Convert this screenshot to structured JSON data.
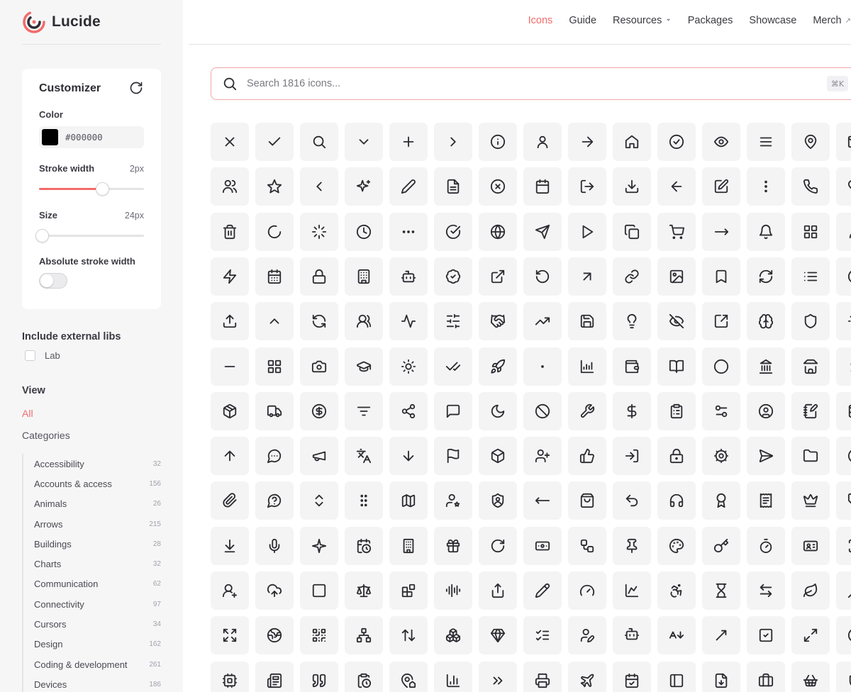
{
  "brand": {
    "name": "Lucide"
  },
  "nav": {
    "links": [
      {
        "label": "Icons",
        "active": true
      },
      {
        "label": "Guide"
      },
      {
        "label": "Resources",
        "dropdown": true
      },
      {
        "label": "Packages"
      },
      {
        "label": "Showcase"
      },
      {
        "label": "Merch",
        "external": true
      }
    ]
  },
  "customizer": {
    "title": "Customizer",
    "color": {
      "label": "Color",
      "value": "#000000"
    },
    "stroke_width": {
      "label": "Stroke width",
      "value": "2px",
      "fraction": 0.6
    },
    "size": {
      "label": "Size",
      "value": "24px",
      "fraction": 0.03
    },
    "absolute_stroke": {
      "label": "Absolute stroke width",
      "enabled": false
    }
  },
  "external_libs": {
    "title": "Include external libs",
    "lab_label": "Lab"
  },
  "view": {
    "title": "View",
    "all_label": "All",
    "categories_label": "Categories"
  },
  "categories": [
    {
      "name": "Accessibility",
      "count": "32"
    },
    {
      "name": "Accounts & access",
      "count": "156"
    },
    {
      "name": "Animals",
      "count": "26"
    },
    {
      "name": "Arrows",
      "count": "215"
    },
    {
      "name": "Buildings",
      "count": "28"
    },
    {
      "name": "Charts",
      "count": "32"
    },
    {
      "name": "Communication",
      "count": "62"
    },
    {
      "name": "Connectivity",
      "count": "97"
    },
    {
      "name": "Cursors",
      "count": "34"
    },
    {
      "name": "Design",
      "count": "162"
    },
    {
      "name": "Coding & development",
      "count": "261"
    },
    {
      "name": "Devices",
      "count": "186"
    }
  ],
  "search": {
    "placeholder": "Search 1816 icons...",
    "shortcut": "⌘K"
  },
  "icons": [
    [
      "x",
      "check",
      "search",
      "chevron-down",
      "plus",
      "chevron-right",
      "info",
      "user",
      "arrow-right",
      "house",
      "circle-check",
      "eye",
      "menu",
      "map-pin",
      "mail"
    ],
    [
      "users",
      "star",
      "chevron-left",
      "sparkles",
      "pencil",
      "file-text",
      "circle-x",
      "calendar",
      "log-out",
      "download",
      "arrow-left",
      "square-pen",
      "ellipsis-vertical",
      "phone",
      "heart"
    ],
    [
      "trash",
      "loader-circle",
      "loader",
      "clock",
      "ellipsis",
      "circle-check-big",
      "globe",
      "send",
      "play",
      "copy",
      "shopping-cart",
      "move-right",
      "bell",
      "layout-grid",
      "user-round"
    ],
    [
      "zap",
      "calendar-days",
      "lock",
      "building",
      "bot",
      "badge-check",
      "external-link",
      "rotate-ccw",
      "arrow-up-right",
      "link",
      "image",
      "bookmark",
      "refresh-cw",
      "list",
      "circle-help"
    ],
    [
      "upload",
      "chevron-up",
      "refresh-ccw",
      "users-round",
      "activity",
      "sliders",
      "handshake",
      "trending-up",
      "save",
      "lightbulb",
      "eye-off",
      "square-arrow-out-up-right",
      "brain",
      "shield",
      "settings"
    ],
    [
      "minus",
      "layout-grid-2",
      "camera",
      "graduation-cap",
      "sun",
      "check-check",
      "rocket",
      "dot",
      "chart-no-axes",
      "wallet",
      "book-open",
      "circle",
      "landmark",
      "store",
      "dollar"
    ],
    [
      "package",
      "truck",
      "circle-dollar-sign",
      "list-filter",
      "share",
      "message-square",
      "moon",
      "ban",
      "wrench",
      "dollar-sign",
      "clipboard-list",
      "settings-2",
      "circle-user",
      "notebook-pen",
      "database"
    ],
    [
      "arrow-up",
      "message-circle-more",
      "megaphone",
      "languages",
      "arrow-down",
      "flag",
      "box",
      "user-plus",
      "thumbs-up",
      "log-in",
      "lock-keyhole",
      "cog",
      "send-horizontal",
      "folder",
      "at-sign"
    ],
    [
      "paperclip",
      "message-circle-question",
      "chevrons-up-down",
      "grip-vertical",
      "map",
      "user-star",
      "shield-user",
      "move-left",
      "shopping-bag",
      "undo",
      "headphones",
      "award",
      "receipt",
      "crown",
      "tag"
    ],
    [
      "arrow-down-to-line",
      "mic",
      "sparkle",
      "calendar-clock",
      "building-2",
      "gift",
      "rotate-cw",
      "banknote",
      "workflow",
      "pin",
      "palette",
      "key",
      "timer",
      "id-card",
      "scan"
    ],
    [
      "user-plus-2",
      "cloud-upload",
      "square",
      "scale",
      "blocks",
      "audio-lines",
      "share-2",
      "pen",
      "gauge",
      "chart-line",
      "accessibility",
      "hourglass",
      "arrow-left-right",
      "leaf",
      "slash"
    ],
    [
      "scan-expand",
      "earth",
      "qr-code",
      "network",
      "arrow-up-down",
      "boxes",
      "gem",
      "list-checks",
      "user-pen",
      "bot-message",
      "a-arrow-down",
      "move-up-right",
      "square-check",
      "maximize-2",
      "circle-plus"
    ],
    [
      "cpu",
      "newspaper",
      "quote",
      "clipboard-clock",
      "map-pin-house",
      "chart-column",
      "chevrons-right",
      "printer",
      "plane",
      "calendar-check",
      "panel-left",
      "file-down",
      "briefcase",
      "shopping-basket",
      "shield-check"
    ]
  ],
  "colors": {
    "accent": "#f26b6b",
    "sidebar_bg": "#f6f6f7",
    "tile_bg": "#f4f4f5"
  }
}
